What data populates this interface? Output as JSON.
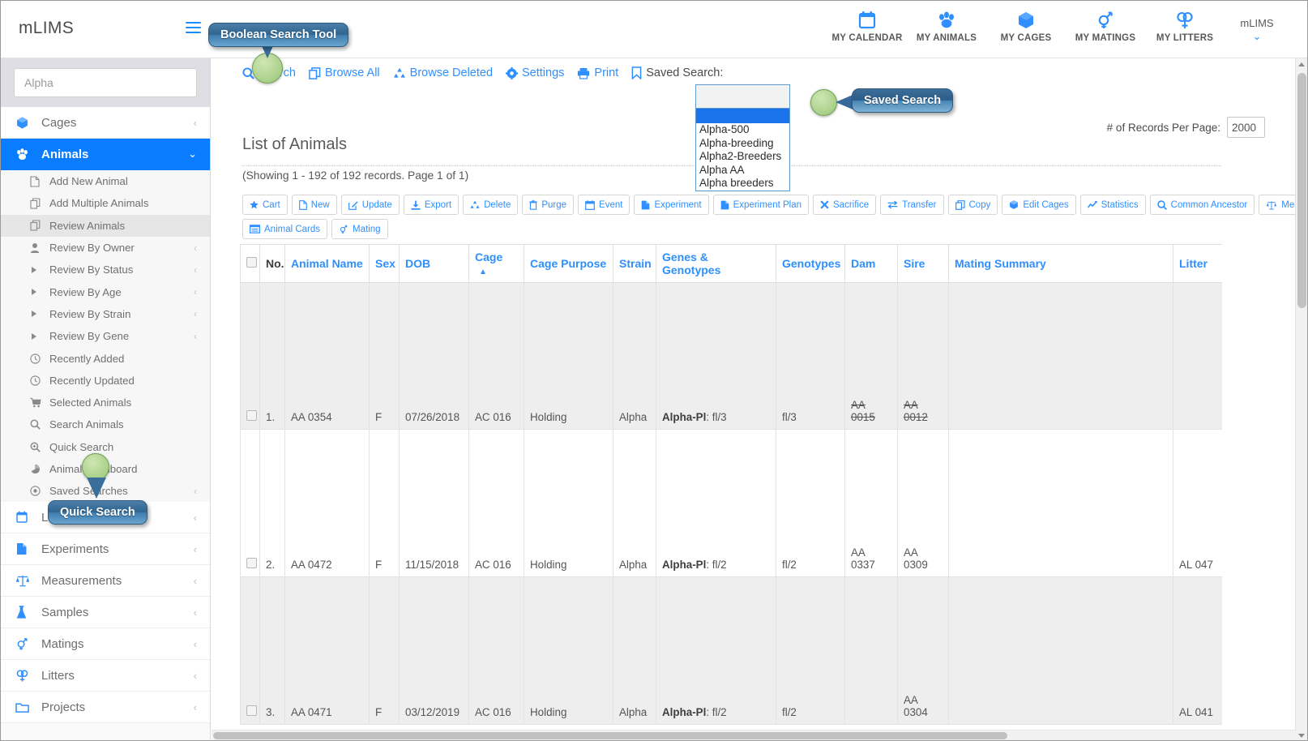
{
  "app": {
    "brand": "mLIMS",
    "user": "mLIMS"
  },
  "topnav": [
    {
      "label": "MY CALENDAR",
      "icon": "calendar-icon"
    },
    {
      "label": "MY ANIMALS",
      "icon": "paw-icon"
    },
    {
      "label": "MY CAGES",
      "icon": "cube-icon"
    },
    {
      "label": "MY MATINGS",
      "icon": "mating-icon"
    },
    {
      "label": "MY LITTERS",
      "icon": "litter-icon"
    }
  ],
  "sidebar": {
    "search_value": "",
    "search_placeholder": "Alpha",
    "groups": [
      {
        "label": "Cages",
        "icon": "cube-icon",
        "caret": "‹",
        "active": false
      },
      {
        "label": "Animals",
        "icon": "paw-icon",
        "caret": "⌄",
        "active": true
      }
    ],
    "animals_items": [
      {
        "label": "Add New Animal",
        "icon": "file-icon",
        "caret": "",
        "selected": false
      },
      {
        "label": "Add Multiple Animals",
        "icon": "copy-icon",
        "caret": "",
        "selected": false
      },
      {
        "label": "Review Animals",
        "icon": "copy-icon",
        "caret": "",
        "selected": true
      },
      {
        "label": "Review By Owner",
        "icon": "user-icon",
        "caret": "‹",
        "selected": false
      },
      {
        "label": "Review By Status",
        "icon": "triangle-right-icon",
        "caret": "‹",
        "selected": false
      },
      {
        "label": "Review By Age",
        "icon": "triangle-right-icon",
        "caret": "‹",
        "selected": false
      },
      {
        "label": "Review By Strain",
        "icon": "triangle-right-icon",
        "caret": "‹",
        "selected": false
      },
      {
        "label": "Review By Gene",
        "icon": "triangle-right-icon",
        "caret": "‹",
        "selected": false
      },
      {
        "label": "Recently Added",
        "icon": "clock-icon",
        "caret": "",
        "selected": false
      },
      {
        "label": "Recently Updated",
        "icon": "clock-icon",
        "caret": "",
        "selected": false
      },
      {
        "label": "Selected Animals",
        "icon": "cart-icon",
        "caret": "",
        "selected": false
      },
      {
        "label": "Search Animals",
        "icon": "search-icon",
        "caret": "",
        "selected": false
      },
      {
        "label": "Quick Search",
        "icon": "zoom-in-icon",
        "caret": "",
        "selected": false
      },
      {
        "label": "Animal Dashboard",
        "icon": "pie-chart-icon",
        "caret": "",
        "selected": false
      },
      {
        "label": "Saved Searches",
        "icon": "record-icon",
        "caret": "‹",
        "selected": false
      }
    ],
    "bottom_groups": [
      {
        "label": "Lab Events",
        "icon": "calendar-icon",
        "caret": "‹"
      },
      {
        "label": "Experiments",
        "icon": "experiment-icon",
        "caret": "‹"
      },
      {
        "label": "Measurements",
        "icon": "scale-icon",
        "caret": "‹"
      },
      {
        "label": "Samples",
        "icon": "flask-icon",
        "caret": "‹"
      },
      {
        "label": "Matings",
        "icon": "mating-icon",
        "caret": "‹"
      },
      {
        "label": "Litters",
        "icon": "litter-icon",
        "caret": "‹"
      },
      {
        "label": "Projects",
        "icon": "folder-icon",
        "caret": "‹"
      }
    ]
  },
  "toolbar": {
    "links": [
      {
        "label": "Search",
        "icon": "search-icon"
      },
      {
        "label": "Browse All",
        "icon": "copy-icon"
      },
      {
        "label": "Browse Deleted",
        "icon": "recycle-icon"
      },
      {
        "label": "Settings",
        "icon": "gear-icon"
      },
      {
        "label": "Print",
        "icon": "printer-icon"
      }
    ],
    "saved_search_label": "Saved Search:",
    "saved_search_icon": "bookmark-icon",
    "saved_search_value": "",
    "saved_search_options": [
      "Alpha-500",
      "Alpha-breeding",
      "Alpha2-Breeders",
      "Alpha AA",
      "Alpha breeders"
    ],
    "records_per_page_label": "# of Records Per Page:",
    "records_per_page_value": "2000"
  },
  "page": {
    "title": "List of Animals",
    "showing": "(Showing 1 - 192 of 192 records. Page 1 of 1)"
  },
  "actions_row1": [
    {
      "label": "Cart",
      "icon": "star-icon"
    },
    {
      "label": "New",
      "icon": "file-icon"
    },
    {
      "label": "Update",
      "icon": "pencil-square-icon"
    },
    {
      "label": "Export",
      "icon": "download-icon"
    },
    {
      "label": "Delete",
      "icon": "recycle-icon"
    },
    {
      "label": "Purge",
      "icon": "trash-icon"
    },
    {
      "label": "Event",
      "icon": "calendar-icon"
    },
    {
      "label": "Experiment",
      "icon": "experiment-icon"
    },
    {
      "label": "Experiment Plan",
      "icon": "experiment-icon"
    },
    {
      "label": "Sacrifice",
      "icon": "x-icon"
    },
    {
      "label": "Transfer",
      "icon": "transfer-icon"
    },
    {
      "label": "Copy",
      "icon": "copy-icon"
    },
    {
      "label": "Edit Cages",
      "icon": "cube-icon"
    },
    {
      "label": "Statistics",
      "icon": "chart-line-icon"
    },
    {
      "label": "Common Ancestor",
      "icon": "search-icon"
    },
    {
      "label": "Measurements",
      "icon": "scale-icon"
    },
    {
      "label": "Me",
      "icon": "table-icon"
    }
  ],
  "actions_row2": [
    {
      "label": "Animal Cards",
      "icon": "card-icon"
    },
    {
      "label": "Mating",
      "icon": "mating-icon"
    }
  ],
  "table": {
    "columns": [
      {
        "label": "",
        "key": "checkbox",
        "style": "dark"
      },
      {
        "label": "No.",
        "key": "no",
        "style": "dark"
      },
      {
        "label": "Animal Name",
        "key": "animal_name",
        "style": "link"
      },
      {
        "label": "Sex",
        "key": "sex",
        "style": "link"
      },
      {
        "label": "DOB",
        "key": "dob",
        "style": "link"
      },
      {
        "label": "Cage",
        "key": "cage",
        "style": "link",
        "sorted": "asc"
      },
      {
        "label": "Cage Purpose",
        "key": "cage_purpose",
        "style": "link"
      },
      {
        "label": "Strain",
        "key": "strain",
        "style": "link"
      },
      {
        "label": "Genes & Genotypes",
        "key": "genes_genotypes",
        "style": "link"
      },
      {
        "label": "Genotypes",
        "key": "genotypes",
        "style": "link"
      },
      {
        "label": "Dam",
        "key": "dam",
        "style": "link"
      },
      {
        "label": "Sire",
        "key": "sire",
        "style": "link"
      },
      {
        "label": "Mating Summary",
        "key": "mating_summary",
        "style": "link"
      },
      {
        "label": "Litter",
        "key": "litter",
        "style": "link"
      }
    ],
    "rows": [
      {
        "no": "1.",
        "animal_name": "AA 0354",
        "sex": "F",
        "dob": "07/26/2018",
        "cage": "AC 016",
        "cage_purpose": "Holding",
        "strain": "Alpha",
        "gene_label": "Alpha-Pl",
        "gene_value": ": fl/3",
        "genotypes": "fl/3",
        "dam": "AA 0015",
        "dam_strike": true,
        "sire": "AA 0012",
        "sire_strike": true,
        "mating_summary": "",
        "litter": ""
      },
      {
        "no": "2.",
        "animal_name": "AA 0472",
        "sex": "F",
        "dob": "11/15/2018",
        "cage": "AC 016",
        "cage_purpose": "Holding",
        "strain": "Alpha",
        "gene_label": "Alpha-Pl",
        "gene_value": ": fl/2",
        "genotypes": "fl/2",
        "dam": "AA 0337",
        "dam_strike": false,
        "sire": "AA 0309",
        "sire_strike": false,
        "mating_summary": "",
        "litter": "AL 047"
      },
      {
        "no": "3.",
        "animal_name": "AA 0471",
        "sex": "F",
        "dob": "03/12/2019",
        "cage": "AC 016",
        "cage_purpose": "Holding",
        "strain": "Alpha",
        "gene_label": "Alpha-Pl",
        "gene_value": ": fl/2",
        "genotypes": "fl/2",
        "dam": "",
        "dam_strike": false,
        "sire": "AA 0304",
        "sire_strike": false,
        "mating_summary": "",
        "litter": "AL 041"
      }
    ]
  },
  "callouts": [
    {
      "label": "Boolean Search Tool"
    },
    {
      "label": "Saved Search"
    },
    {
      "label": "Quick Search"
    }
  ],
  "colors": {
    "accent": "#2f8fff",
    "active_nav": "#0a7cff",
    "link": "#2f8fff",
    "danger": "#cc2222",
    "callout": "#3a6f9b",
    "dot": "#a9d089"
  }
}
